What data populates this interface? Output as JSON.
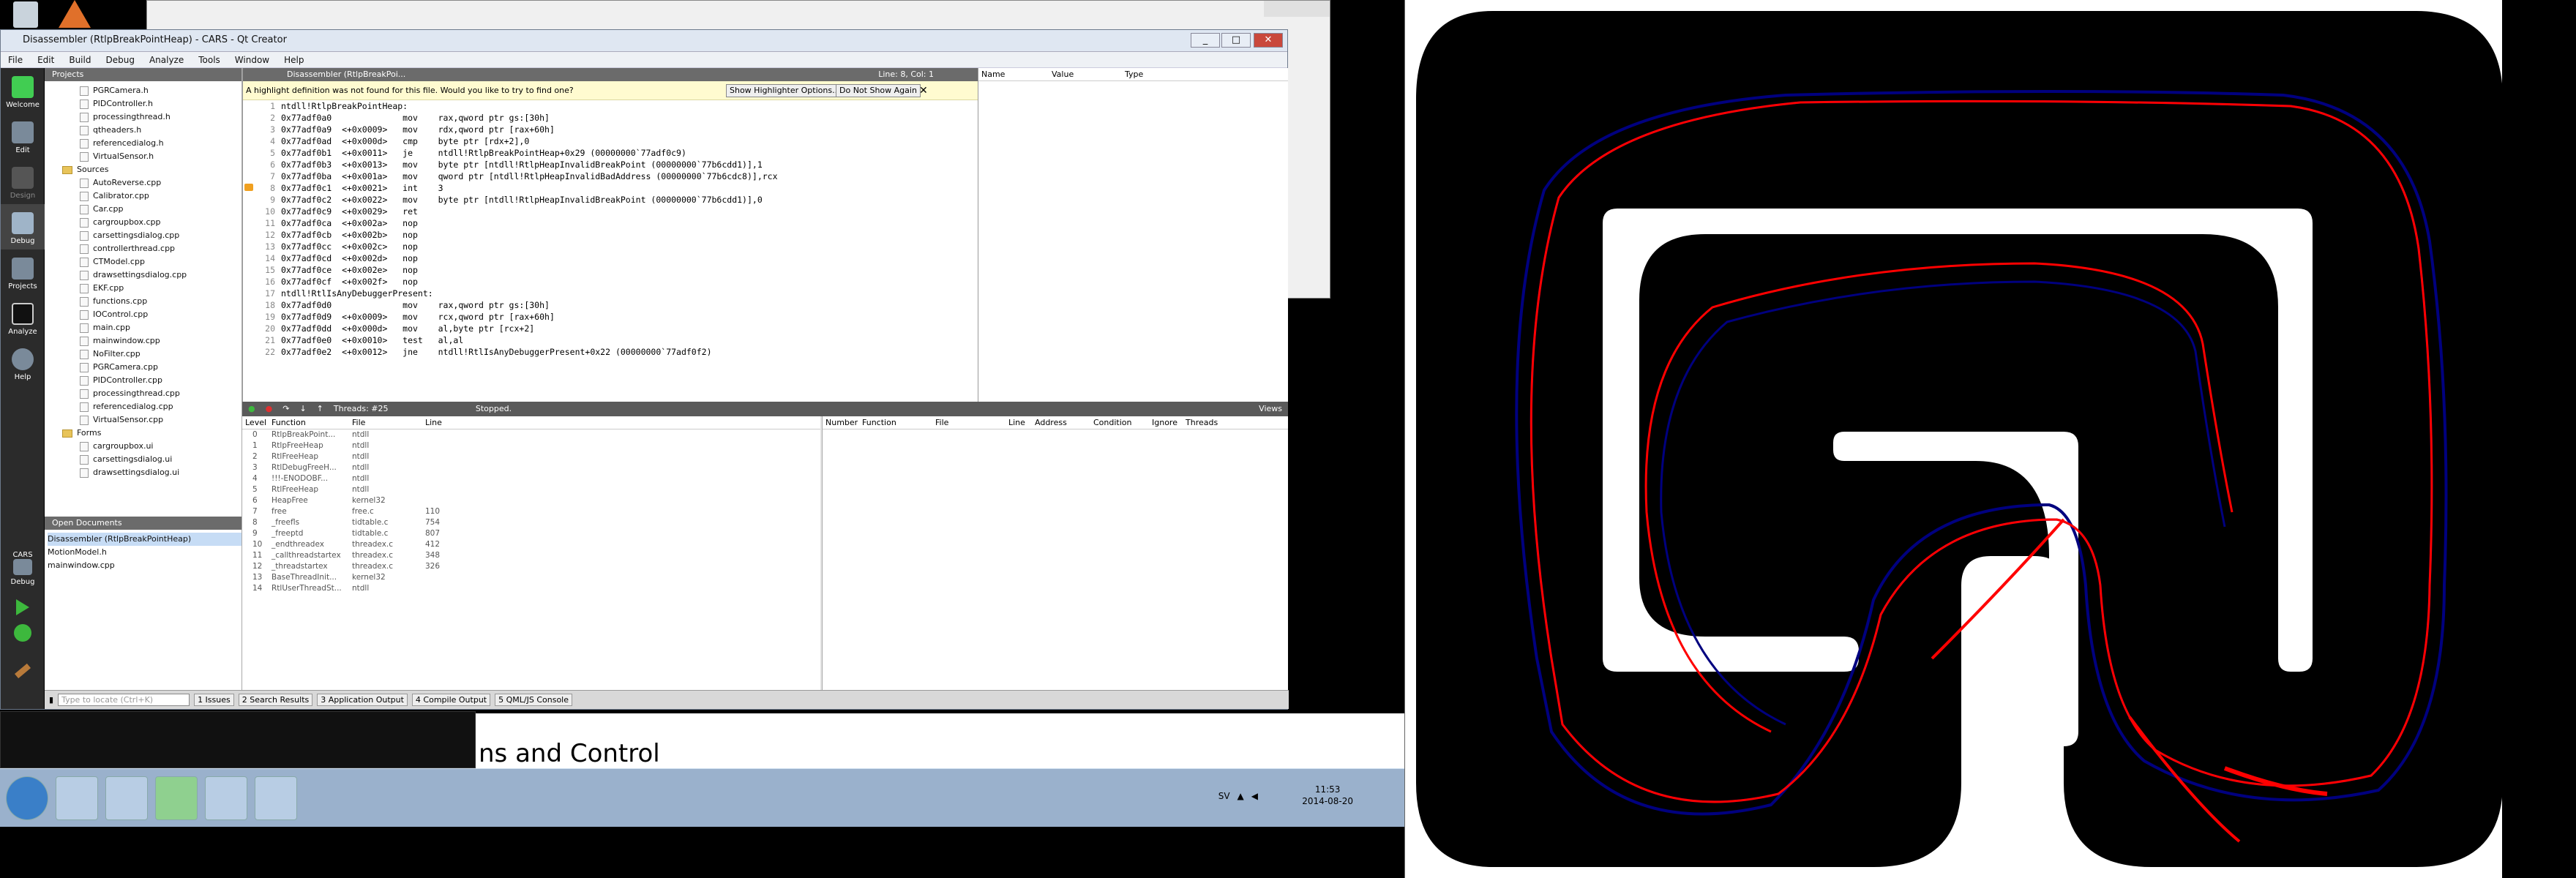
{
  "window": {
    "title": "Disassembler (RtlpBreakPointHeap) - CARS - Qt Creator"
  },
  "menu": [
    "File",
    "Edit",
    "Build",
    "Debug",
    "Analyze",
    "Tools",
    "Window",
    "Help"
  ],
  "modes": [
    {
      "label": "Welcome",
      "icon": "qt-logo-icon"
    },
    {
      "label": "Edit",
      "icon": "edit-icon"
    },
    {
      "label": "Design",
      "icon": "design-icon"
    },
    {
      "label": "Debug",
      "icon": "debug-icon"
    },
    {
      "label": "Projects",
      "icon": "projects-icon"
    },
    {
      "label": "Analyze",
      "icon": "analyze-icon"
    },
    {
      "label": "Help",
      "icon": "help-icon"
    }
  ],
  "kit": {
    "project": "CARS",
    "mode": "Debug"
  },
  "projects": {
    "title": "Projects",
    "items": [
      {
        "label": "PGRCamera.h",
        "kind": "file"
      },
      {
        "label": "PIDController.h",
        "kind": "file"
      },
      {
        "label": "processingthread.h",
        "kind": "file"
      },
      {
        "label": "qtheaders.h",
        "kind": "file"
      },
      {
        "label": "referencedialog.h",
        "kind": "file"
      },
      {
        "label": "VirtualSensor.h",
        "kind": "file"
      },
      {
        "label": "Sources",
        "kind": "folder"
      },
      {
        "label": "AutoReverse.cpp",
        "kind": "file"
      },
      {
        "label": "Calibrator.cpp",
        "kind": "file"
      },
      {
        "label": "Car.cpp",
        "kind": "file"
      },
      {
        "label": "cargroupbox.cpp",
        "kind": "file"
      },
      {
        "label": "carsettingsdialog.cpp",
        "kind": "file"
      },
      {
        "label": "controllerthread.cpp",
        "kind": "file"
      },
      {
        "label": "CTModel.cpp",
        "kind": "file"
      },
      {
        "label": "drawsettingsdialog.cpp",
        "kind": "file"
      },
      {
        "label": "EKF.cpp",
        "kind": "file"
      },
      {
        "label": "functions.cpp",
        "kind": "file"
      },
      {
        "label": "IOControl.cpp",
        "kind": "file"
      },
      {
        "label": "main.cpp",
        "kind": "file"
      },
      {
        "label": "mainwindow.cpp",
        "kind": "file"
      },
      {
        "label": "NoFilter.cpp",
        "kind": "file"
      },
      {
        "label": "PGRCamera.cpp",
        "kind": "file"
      },
      {
        "label": "PIDController.cpp",
        "kind": "file"
      },
      {
        "label": "processingthread.cpp",
        "kind": "file"
      },
      {
        "label": "referencedialog.cpp",
        "kind": "file"
      },
      {
        "label": "VirtualSensor.cpp",
        "kind": "file"
      },
      {
        "label": "Forms",
        "kind": "folder"
      },
      {
        "label": "cargroupbox.ui",
        "kind": "file"
      },
      {
        "label": "carsettingsdialog.ui",
        "kind": "file"
      },
      {
        "label": "drawsettingsdialog.ui",
        "kind": "file"
      }
    ]
  },
  "open_documents": {
    "title": "Open Documents",
    "items": [
      "Disassembler (RtlpBreakPointHeap)",
      "MotionModel.h",
      "mainwindow.cpp"
    ]
  },
  "editor": {
    "tab": "Disassembler (RtlpBreakPoi...",
    "position": "Line: 8, Col: 1",
    "highlight_msg": "A highlight definition was not found for this file. Would you like to try to find one?",
    "show_options": "Show Highlighter Options...",
    "dont_show": "Do Not Show Again",
    "lines": [
      "ntdll!RtlpBreakPointHeap:",
      "0x77adf0a0              mov    rax,qword ptr gs:[30h]",
      "0x77adf0a9  <+0x0009>   mov    rdx,qword ptr [rax+60h]",
      "0x77adf0ad  <+0x000d>   cmp    byte ptr [rdx+2],0",
      "0x77adf0b1  <+0x0011>   je     ntdll!RtlpBreakPointHeap+0x29 (00000000`77adf0c9)",
      "0x77adf0b3  <+0x0013>   mov    byte ptr [ntdll!RtlpHeapInvalidBreakPoint (00000000`77b6cdd1)],1",
      "0x77adf0ba  <+0x001a>   mov    qword ptr [ntdll!RtlpHeapInvalidBadAddress (00000000`77b6cdc8)],rcx",
      "0x77adf0c1  <+0x0021>   int    3",
      "0x77adf0c2  <+0x0022>   mov    byte ptr [ntdll!RtlpHeapInvalidBreakPoint (00000000`77b6cdd1)],0",
      "0x77adf0c9  <+0x0029>   ret",
      "0x77adf0ca  <+0x002a>   nop",
      "0x77adf0cb  <+0x002b>   nop",
      "0x77adf0cc  <+0x002c>   nop",
      "0x77adf0cd  <+0x002d>   nop",
      "0x77adf0ce  <+0x002e>   nop",
      "0x77adf0cf  <+0x002f>   nop",
      "ntdll!RtlIsAnyDebuggerPresent:",
      "0x77adf0d0              mov    rax,qword ptr gs:[30h]",
      "0x77adf0d9  <+0x0009>   mov    rcx,qword ptr [rax+60h]",
      "0x77adf0dd  <+0x000d>   mov    al,byte ptr [rcx+2]",
      "0x77adf0e0  <+0x0010>   test   al,al",
      "0x77adf0e2  <+0x0012>   jne    ntdll!RtlIsAnyDebuggerPresent+0x22 (00000000`77adf0f2)"
    ]
  },
  "locals": {
    "headers": [
      "Name",
      "Value",
      "Type"
    ]
  },
  "debugbar": {
    "threads": "Threads: #25",
    "state": "Stopped.",
    "views": "Views"
  },
  "stack": {
    "headers": [
      "Level",
      "Function",
      "File",
      "Line"
    ],
    "rows": [
      [
        "0",
        "RtlpBreakPoint...",
        "ntdll",
        ""
      ],
      [
        "1",
        "RtlpFreeHeap",
        "ntdll",
        ""
      ],
      [
        "2",
        "RtlFreeHeap",
        "ntdll",
        ""
      ],
      [
        "3",
        "RtlDebugFreeH...",
        "ntdll",
        ""
      ],
      [
        "4",
        "!!!-ENODOBF...",
        "ntdll",
        ""
      ],
      [
        "5",
        "RtlFreeHeap",
        "ntdll",
        ""
      ],
      [
        "6",
        "HeapFree",
        "kernel32",
        ""
      ],
      [
        "7",
        "free",
        "free.c",
        "110"
      ],
      [
        "8",
        "_freefls",
        "tidtable.c",
        "754"
      ],
      [
        "9",
        "_freeptd",
        "tidtable.c",
        "807"
      ],
      [
        "10",
        "_endthreadex",
        "threadex.c",
        "412"
      ],
      [
        "11",
        "_callthreadstartex",
        "threadex.c",
        "348"
      ],
      [
        "12",
        "_threadstartex",
        "threadex.c",
        "326"
      ],
      [
        "13",
        "BaseThreadInit...",
        "kernel32",
        ""
      ],
      [
        "14",
        "RtlUserThreadSt...",
        "ntdll",
        ""
      ]
    ]
  },
  "breakpoints": {
    "headers": [
      "Number",
      "Function",
      "File",
      "Line",
      "Address",
      "Condition",
      "Ignore",
      "Threads"
    ]
  },
  "statusbar": {
    "locate_placeholder": "Type to locate (Ctrl+K)",
    "panes": [
      "1  Issues",
      "2  Search Results",
      "3  Application Output",
      "4  Compile Output",
      "5  QML/JS Console"
    ]
  },
  "background_text": "ns and Control",
  "taskbar": {
    "lang": "SV",
    "time": "11:53",
    "date": "2014-08-20"
  },
  "colors": {
    "track": "#000000",
    "trajectory_a": "#ff0000",
    "trajectory_b": "#00007f"
  }
}
